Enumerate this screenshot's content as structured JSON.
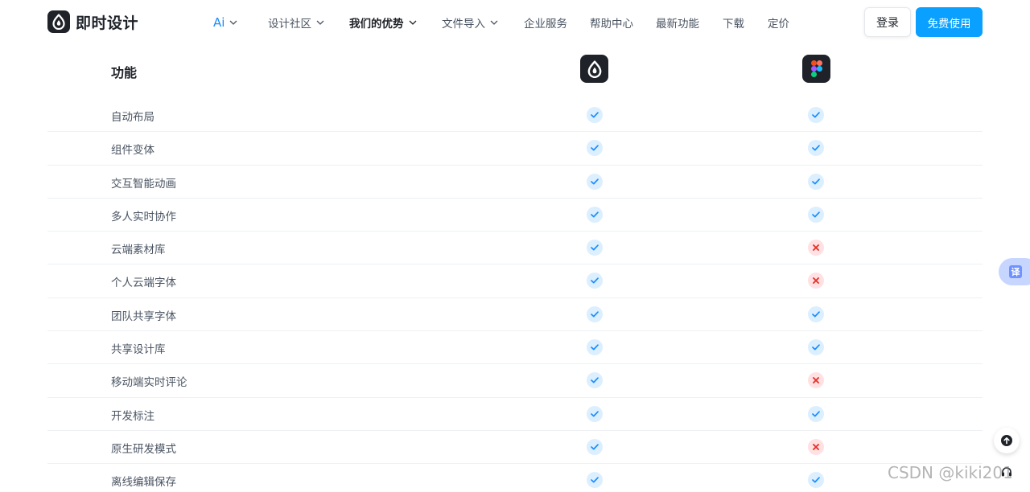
{
  "brand": {
    "name": "即时设计"
  },
  "nav": {
    "ai": "Ai",
    "community": "设计社区",
    "advantages": "我们的优势",
    "import": "文件导入",
    "enterprise": "企业服务",
    "help": "帮助中心",
    "features": "最新功能",
    "download": "下载",
    "pricing": "定价"
  },
  "actions": {
    "login": "登录",
    "free": "免费使用"
  },
  "table": {
    "header": "功能",
    "rows": [
      {
        "label": "自动布局",
        "a": true,
        "b": true
      },
      {
        "label": "组件变体",
        "a": true,
        "b": true
      },
      {
        "label": "交互智能动画",
        "a": true,
        "b": true
      },
      {
        "label": "多人实时协作",
        "a": true,
        "b": true
      },
      {
        "label": "云端素材库",
        "a": true,
        "b": false
      },
      {
        "label": "个人云端字体",
        "a": true,
        "b": false
      },
      {
        "label": "团队共享字体",
        "a": true,
        "b": true
      },
      {
        "label": "共享设计库",
        "a": true,
        "b": true
      },
      {
        "label": "移动端实时评论",
        "a": true,
        "b": false
      },
      {
        "label": "开发标注",
        "a": true,
        "b": true
      },
      {
        "label": "原生研发模式",
        "a": true,
        "b": false
      },
      {
        "label": "离线编辑保存",
        "a": true,
        "b": true
      }
    ]
  },
  "floating": {
    "translate": "译"
  },
  "watermark": "CSDN @kiki201",
  "colors": {
    "accent": "#0aa0ff",
    "check_bg": "#dcefff",
    "check": "#1a8cff",
    "cross_bg": "#ffe1e3",
    "cross": "#e5342b"
  }
}
